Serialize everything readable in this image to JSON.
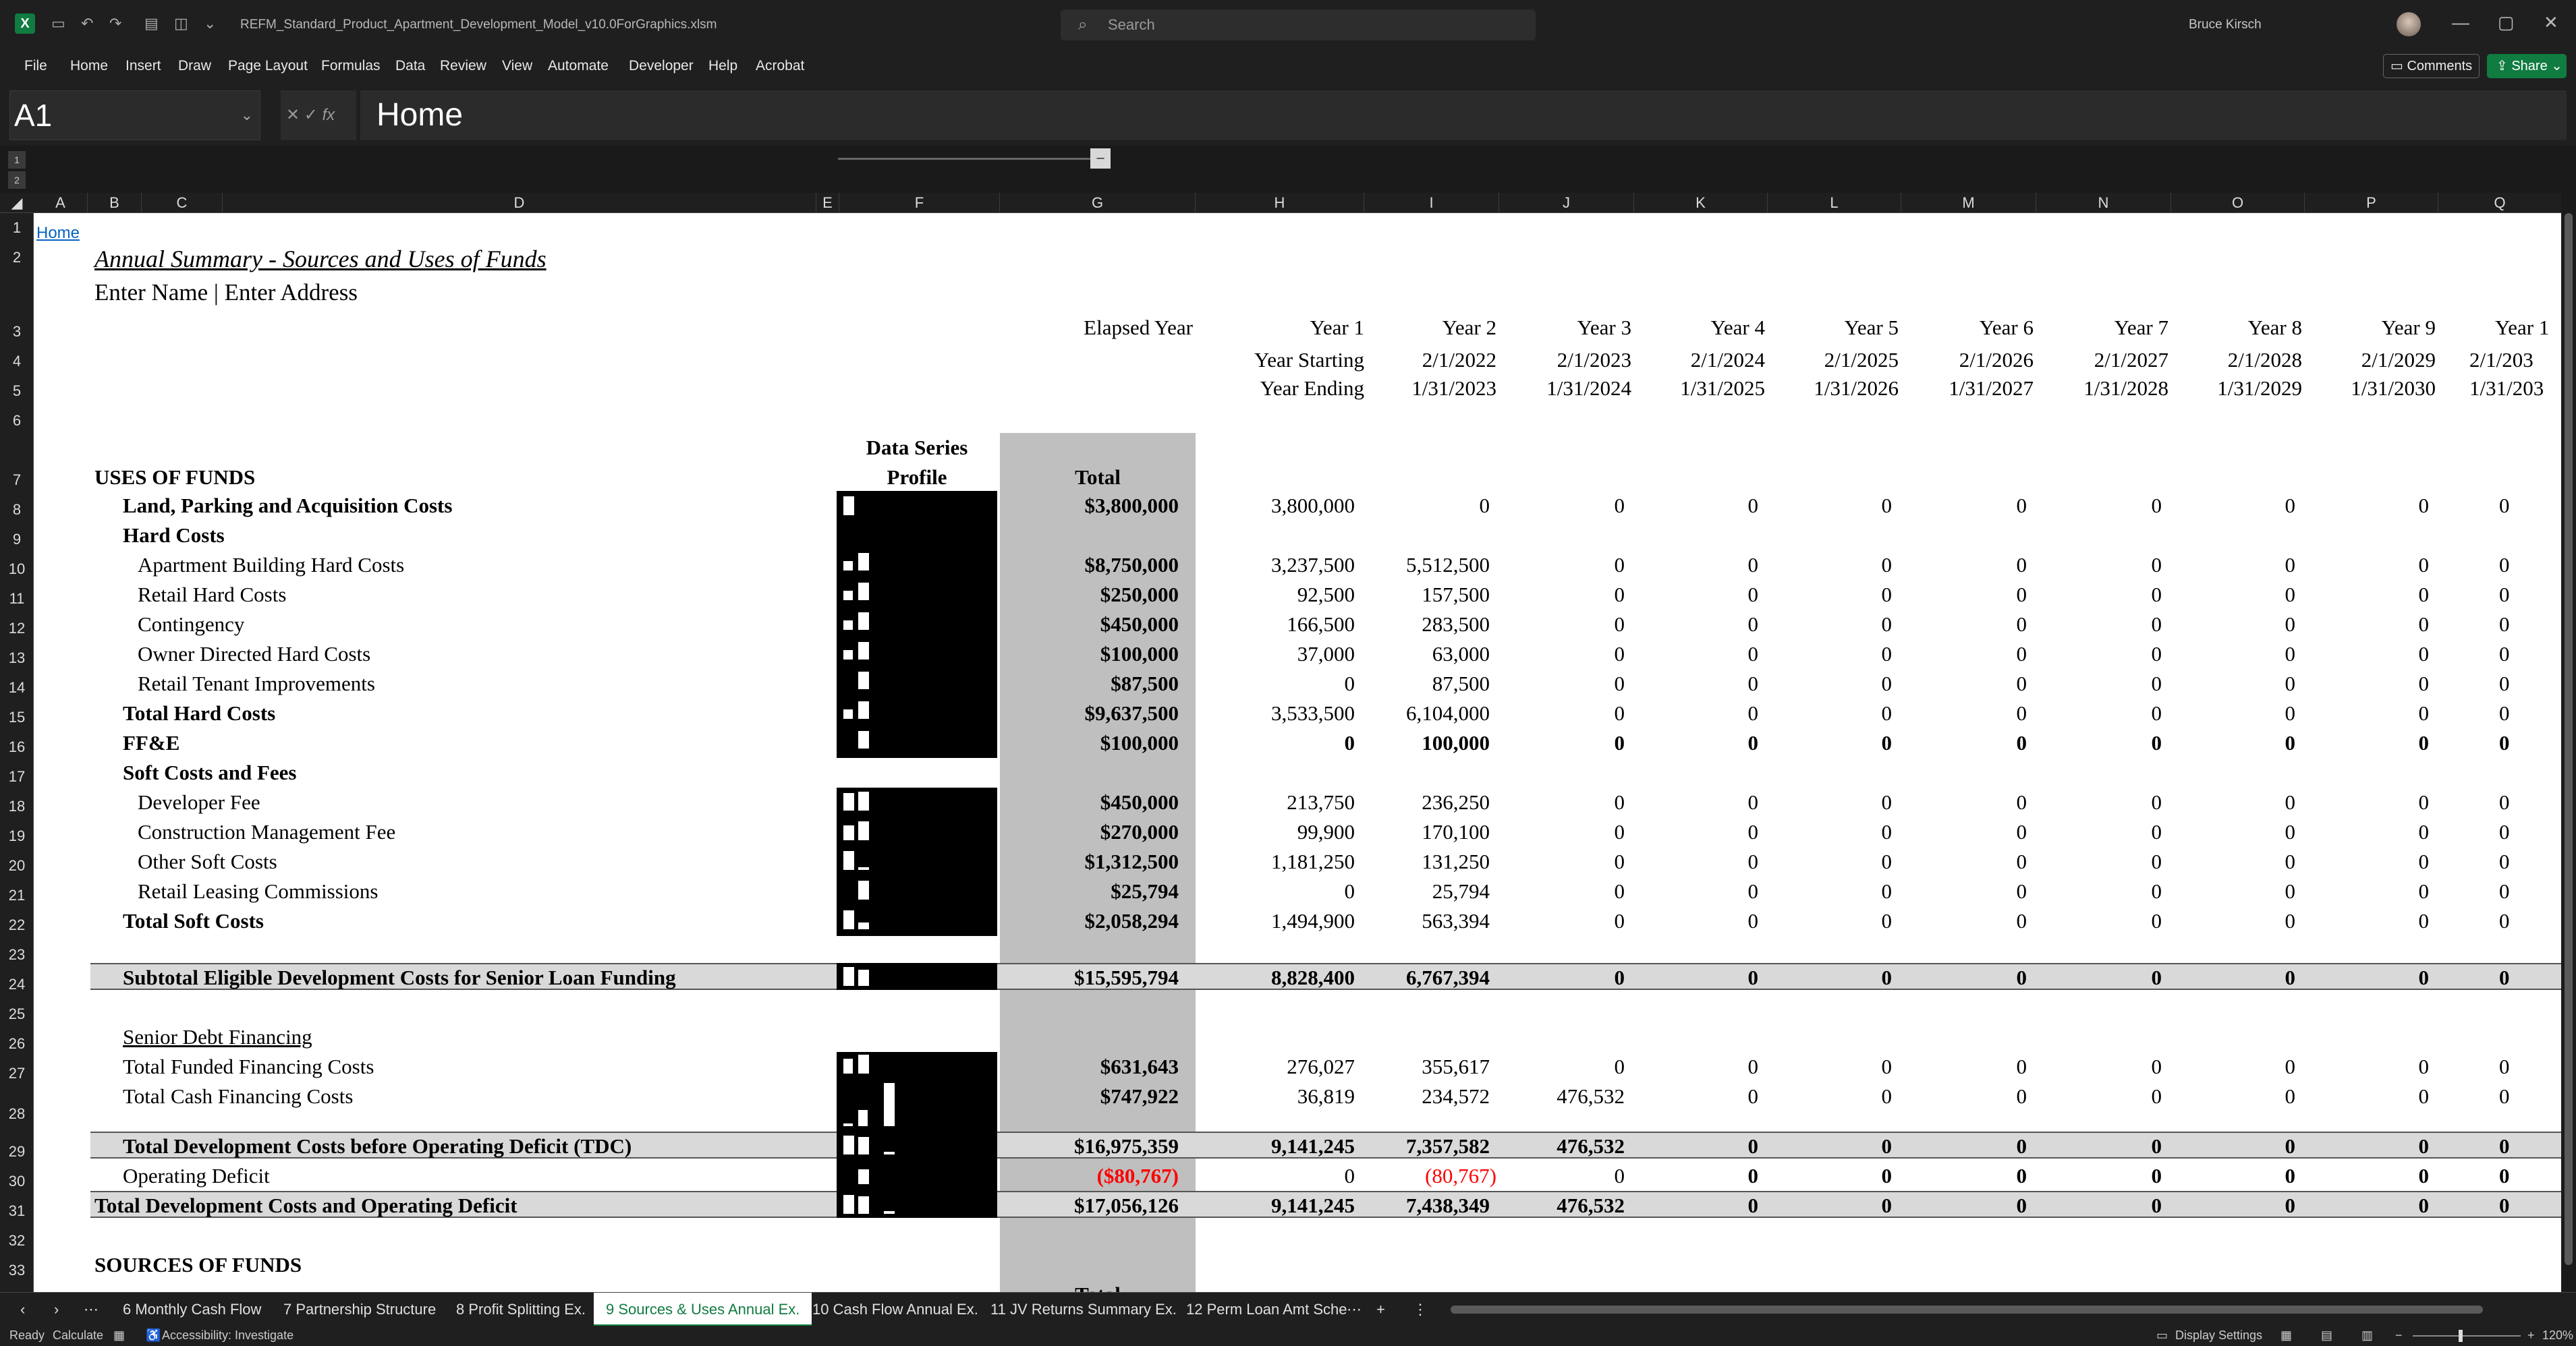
{
  "titlebar": {
    "filename": "REFM_Standard_Product_Apartment_Development_Model_v10.0ForGraphics.xlsm",
    "search_placeholder": "Search",
    "user": "Bruce Kirsch"
  },
  "menu": [
    "File",
    "Home",
    "Insert",
    "Draw",
    "Page Layout",
    "Formulas",
    "Data",
    "Review",
    "View",
    "Automate",
    "Developer",
    "Help",
    "Acrobat"
  ],
  "buttons": {
    "comments": "Comments",
    "share": "Share"
  },
  "formula_bar": {
    "cell_ref": "A1",
    "content": "Home",
    "fx": "fx"
  },
  "columns": [
    "A",
    "B",
    "C",
    "D",
    "E",
    "F",
    "G",
    "H",
    "I",
    "J",
    "K",
    "L",
    "M",
    "N",
    "O",
    "P",
    "Q"
  ],
  "rows": [
    "1",
    "2",
    "3",
    "4",
    "5",
    "6",
    "7",
    "8",
    "9",
    "10",
    "11",
    "12",
    "13",
    "14",
    "15",
    "16",
    "17",
    "18",
    "19",
    "20",
    "21",
    "22",
    "23",
    "24",
    "25",
    "26",
    "27",
    "28",
    "29",
    "30",
    "31",
    "32",
    "33"
  ],
  "sheet": {
    "home_link": "Home",
    "title": "Annual Summary - Sources and Uses of Funds",
    "subtitle": "Enter Name | Enter Address",
    "elapsed_label": "Elapsed Year",
    "year_starting_label": "Year Starting",
    "year_ending_label": "Year Ending",
    "years": [
      "Year 1",
      "Year 2",
      "Year 3",
      "Year 4",
      "Year 5",
      "Year 6",
      "Year 7",
      "Year 8",
      "Year 9",
      "Year 1"
    ],
    "starts": [
      "2/1/2022",
      "2/1/2023",
      "2/1/2024",
      "2/1/2025",
      "2/1/2026",
      "2/1/2027",
      "2/1/2028",
      "2/1/2029",
      "2/1/203"
    ],
    "ends": [
      "1/31/2023",
      "1/31/2024",
      "1/31/2025",
      "1/31/2026",
      "1/31/2027",
      "1/31/2028",
      "1/31/2029",
      "1/31/2030",
      "1/31/203"
    ],
    "data_series_label_1": "Data Series",
    "data_series_label_2": "Profile",
    "total_label": "Total",
    "uses_header": "USES OF FUNDS",
    "sources_header": "SOURCES OF FUNDS",
    "senior_debt_label": "Senior Debt Financing",
    "lines": {
      "land": {
        "label": "Land, Parking and Acquisition Costs",
        "total": "$3,800,000",
        "h": "3,800,000",
        "i": "0"
      },
      "hard_costs_header": {
        "label": "Hard Costs"
      },
      "apt_hard": {
        "label": "Apartment Building Hard Costs",
        "total": "$8,750,000",
        "h": "3,237,500",
        "i": "5,512,500"
      },
      "retail_hard": {
        "label": "Retail Hard Costs",
        "total": "$250,000",
        "h": "92,500",
        "i": "157,500"
      },
      "contingency": {
        "label": "Contingency",
        "total": "$450,000",
        "h": "166,500",
        "i": "283,500"
      },
      "owner_directed": {
        "label": "Owner Directed Hard Costs",
        "total": "$100,000",
        "h": "37,000",
        "i": "63,000"
      },
      "retail_ti": {
        "label": "Retail Tenant Improvements",
        "total": "$87,500",
        "h": "0",
        "i": "87,500"
      },
      "total_hard": {
        "label": "Total Hard Costs",
        "total": "$9,637,500",
        "h": "3,533,500",
        "i": "6,104,000"
      },
      "ffe": {
        "label": "FF&E",
        "total": "$100,000",
        "h": "0",
        "i": "100,000"
      },
      "soft_header": {
        "label": "Soft Costs and Fees"
      },
      "dev_fee": {
        "label": "Developer Fee",
        "total": "$450,000",
        "h": "213,750",
        "i": "236,250"
      },
      "cm_fee": {
        "label": "Construction Management Fee",
        "total": "$270,000",
        "h": "99,900",
        "i": "170,100"
      },
      "other_soft": {
        "label": "Other Soft Costs",
        "total": "$1,312,500",
        "h": "1,181,250",
        "i": "131,250"
      },
      "retail_leasing": {
        "label": "Retail Leasing Commissions",
        "total": "$25,794",
        "h": "0",
        "i": "25,794"
      },
      "total_soft": {
        "label": "Total Soft Costs",
        "total": "$2,058,294",
        "h": "1,494,900",
        "i": "563,394"
      },
      "subtotal": {
        "label": "Subtotal Eligible Development Costs for Senior Loan Funding",
        "total": "$15,595,794",
        "h": "8,828,400",
        "i": "6,767,394"
      },
      "funded_fin": {
        "label": "Total Funded Financing Costs",
        "total": "$631,643",
        "h": "276,027",
        "i": "355,617",
        "j": "0"
      },
      "cash_fin": {
        "label": "Total Cash Financing Costs",
        "total": "$747,922",
        "h": "36,819",
        "i": "234,572",
        "j": "476,532"
      },
      "tdc": {
        "label": "Total Development Costs before Operating Deficit (TDC)",
        "total": "$16,975,359",
        "h": "9,141,245",
        "i": "7,357,582",
        "j": "476,532"
      },
      "op_deficit": {
        "label": "Operating Deficit",
        "total": "($80,767)",
        "h": "0",
        "i": "(80,767)",
        "j": "0"
      },
      "total_dev": {
        "label": "Total Development Costs and Operating Deficit",
        "total": "$17,056,126",
        "h": "9,141,245",
        "i": "7,438,349",
        "j": "476,532"
      }
    },
    "zero": "0",
    "sources_total_partial": "Total"
  },
  "tabs": [
    "6 Monthly Cash Flow",
    "7 Partnership Structure",
    "8 Profit Splitting Ex.",
    "9 Sources & Uses Annual Ex.",
    "10 Cash Flow Annual Ex.",
    "11 JV Returns Summary Ex.",
    "12 Perm Loan Amt Sche"
  ],
  "status": {
    "ready": "Ready",
    "calculate": "Calculate",
    "accessibility": "Accessibility: Investigate",
    "display": "Display Settings",
    "zoom": "120%"
  }
}
